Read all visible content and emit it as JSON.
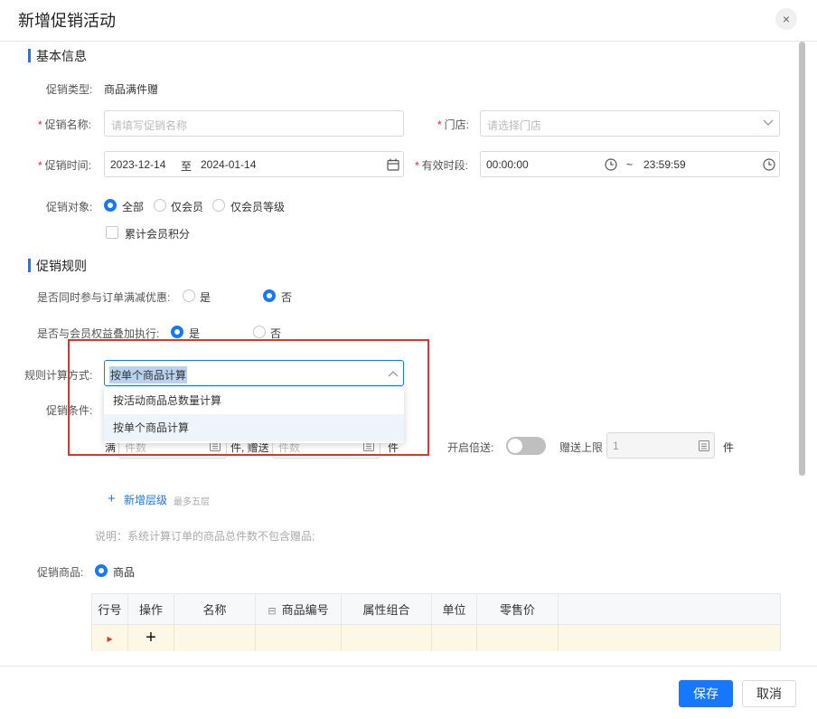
{
  "dialog": {
    "title": "新增促销活动",
    "close": "×"
  },
  "basic": {
    "section_title": "基本信息",
    "type_label": "促销类型:",
    "type_value": "商品满件赠",
    "name_label": "促销名称:",
    "name_placeholder": "请填写促销名称",
    "store_label": "门店:",
    "store_placeholder": "请选择门店",
    "time_label": "促销时间:",
    "start_date": "2023-12-14",
    "date_sep": "至",
    "end_date": "2024-01-14",
    "period_label": "有效时段:",
    "start_time": "00:00:00",
    "time_sep": "~",
    "end_time": "23:59:59",
    "target_label": "促销对象:",
    "target_options": [
      "全部",
      "仅会员",
      "仅会员等级"
    ],
    "target_selected": "全部",
    "points_label": "累计会员积分"
  },
  "rules": {
    "section_title": "促销规则",
    "order_discount_label": "是否同时参与订单满减优惠:",
    "order_discount_yes": "是",
    "order_discount_no": "否",
    "order_discount_selected": "否",
    "member_rights_label": "是否与会员权益叠加执行:",
    "member_rights_yes": "是",
    "member_rights_no": "否",
    "member_rights_selected": "是",
    "calc_label": "规则计算方式:",
    "calc_value": "按单个商品计算",
    "calc_options": [
      "按活动商品总数量计算",
      "按单个商品计算"
    ],
    "condition_label": "促销条件:",
    "cond_prefix": "满",
    "cond_qty_placeholder": "件数",
    "cond_mid": "件, 赠送",
    "cond_gift_placeholder": "件数",
    "cond_suffix": "件",
    "double_label": "开启倍送:",
    "double_on": false,
    "cap_label": "赠送上限",
    "cap_value": "1",
    "cap_unit": "件",
    "add_level": "新增层级",
    "add_level_hint": "最多五层",
    "note": "说明：系统计算订单的商品总件数不包含赠品;"
  },
  "products": {
    "label": "促销商品:",
    "option": "商品",
    "table_headers": [
      "行号",
      "操作",
      "名称",
      "商品编号",
      "属性组合",
      "单位",
      "零售价"
    ],
    "row_marker": "▸",
    "add_symbol": "+"
  },
  "footer": {
    "save": "保存",
    "cancel": "取消"
  },
  "colors": {
    "accent": "#1677ff",
    "required": "#f5222d",
    "highlight_border": "#e5322d",
    "row_bg": "#fdf8e6"
  }
}
